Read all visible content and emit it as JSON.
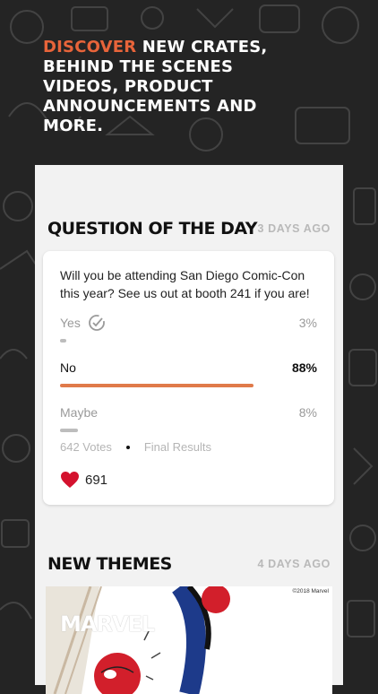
{
  "headline": {
    "accent": "DISCOVER",
    "rest": " NEW CRATES, BEHIND THE SCENES VIDEOS, PRODUCT ANNOUNCEMENTS AND MORE."
  },
  "qotd": {
    "title": "QUESTION OF THE DAY",
    "date": "3 DAYS AGO",
    "question": "Will you be attending San Diego Comic-Con this year? See us out at booth 241 if you are!",
    "options": [
      {
        "label": "Yes",
        "percent": "3%",
        "fraction": 0.03,
        "color": "#bdbdbd",
        "checked_icon": "check-circle-icon"
      },
      {
        "label": "No",
        "percent": "88%",
        "fraction": 0.88,
        "color": "#e07a4a"
      },
      {
        "label": "Maybe",
        "percent": "8%",
        "fraction": 0.08,
        "color": "#bdbdbd"
      }
    ],
    "votes": "642 Votes",
    "status": "Final Results",
    "likes": "691",
    "heart_color": "#d4122e"
  },
  "themes": {
    "title": "NEW THEMES",
    "date": "4 DAYS AGO",
    "copyright": "©2018 Marvel",
    "logo_text": "MARVEL"
  },
  "colors": {
    "accent": "#e8643a",
    "background": "#242424",
    "panel": "#f2f2f2"
  }
}
